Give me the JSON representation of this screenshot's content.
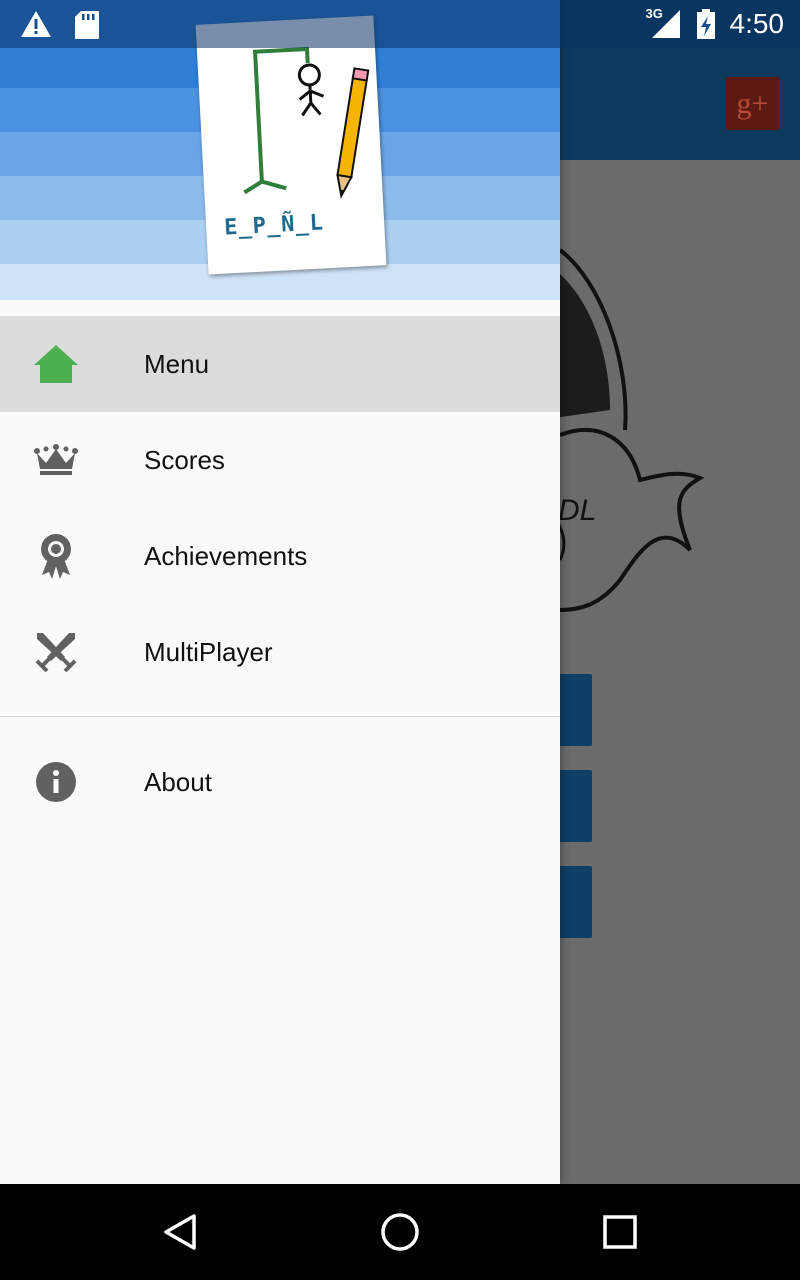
{
  "status_bar": {
    "time": "4:50",
    "network": "3G",
    "icons": [
      "warning-icon",
      "sd-card-icon",
      "signal-icon",
      "battery-charging-icon"
    ]
  },
  "background_app": {
    "share_button": "g+"
  },
  "drawer": {
    "logo_word": "E_P_Ñ_L",
    "items": [
      {
        "label": "Menu",
        "icon": "home-icon",
        "selected": true
      },
      {
        "label": "Scores",
        "icon": "crown-icon",
        "selected": false
      },
      {
        "label": "Achievements",
        "icon": "award-icon",
        "selected": false
      },
      {
        "label": "MultiPlayer",
        "icon": "crossed-swords-icon",
        "selected": false
      }
    ],
    "secondary_items": [
      {
        "label": "About",
        "icon": "info-icon"
      }
    ]
  },
  "colors": {
    "home_icon": "#4caf50",
    "icon_gray": "#616161",
    "selected_bg": "#dcdcdc"
  },
  "nav_bar": {
    "buttons": [
      "back-icon",
      "home-circle-icon",
      "recents-icon"
    ]
  }
}
